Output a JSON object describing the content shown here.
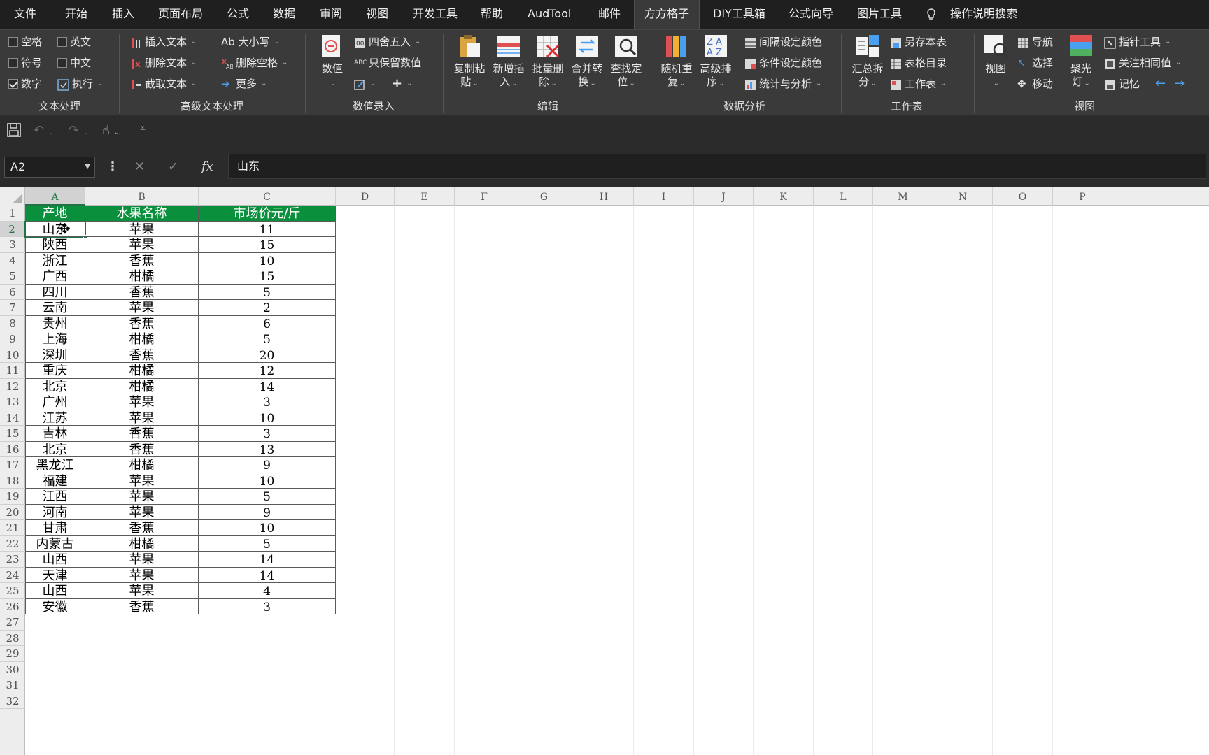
{
  "menu": {
    "tabs": [
      "文件",
      "开始",
      "插入",
      "页面布局",
      "公式",
      "数据",
      "审阅",
      "视图",
      "开发工具",
      "帮助",
      "AudTool",
      "邮件",
      "方方格子",
      "DIY工具箱",
      "公式向导",
      "图片工具"
    ],
    "active_tab": "方方格子",
    "search_label": "操作说明搜索"
  },
  "ribbon": {
    "text_processing": {
      "label": "文本处理",
      "checkboxes": [
        {
          "label": "空格",
          "checked": false
        },
        {
          "label": "英文",
          "checked": false
        },
        {
          "label": "符号",
          "checked": false
        },
        {
          "label": "中文",
          "checked": false
        },
        {
          "label": "数字",
          "checked": true
        }
      ],
      "execute_label": "执行"
    },
    "advanced_text": {
      "label": "高级文本处理",
      "insert_text": "插入文本",
      "delete_text": "删除文本",
      "extract_text": "截取文本",
      "case": "Ab 大小写",
      "delete_space": "删除空格",
      "more": "更多"
    },
    "number_entry": {
      "label": "数值录入",
      "value": "数值",
      "round": "四舍五入",
      "keep_numbers": "只保留数值"
    },
    "edit": {
      "label": "编辑",
      "buttons": [
        {
          "line1": "复制粘",
          "line2": "贴"
        },
        {
          "line1": "新增插",
          "line2": "入"
        },
        {
          "line1": "批量删",
          "line2": "除"
        },
        {
          "line1": "合并转",
          "line2": "换"
        },
        {
          "line1": "查找定",
          "line2": "位"
        }
      ]
    },
    "data_analysis": {
      "label": "数据分析",
      "random": {
        "line1": "随机重",
        "line2": "复"
      },
      "sort": {
        "line1": "高级排",
        "line2": "序"
      },
      "interval_color": "间隔设定颜色",
      "cond_color": "条件设定颜色",
      "stats": "统计与分析"
    },
    "worksheet": {
      "label": "工作表",
      "summary": {
        "line1": "汇总拆",
        "line2": "分"
      },
      "save_as": "另存本表",
      "toc": "表格目录",
      "sheet": "工作表"
    },
    "view": {
      "label": "视图",
      "view_btn": "视图",
      "nav": "导航",
      "select": "选择",
      "move": "移动",
      "spotlight": {
        "line1": "聚光",
        "line2": "灯"
      },
      "pointer_tool": "指针工具",
      "focus_same": "关注相同值",
      "memory": "记忆"
    }
  },
  "formula_bar": {
    "name_box": "A2",
    "fx": "fx",
    "content": "山东"
  },
  "grid": {
    "columns": [
      "A",
      "B",
      "C",
      "D",
      "E",
      "F",
      "G",
      "H",
      "I",
      "J",
      "K",
      "L",
      "M",
      "N",
      "O",
      "P"
    ],
    "rows": [
      "1",
      "2",
      "3",
      "4",
      "5",
      "6",
      "7",
      "8",
      "9",
      "10",
      "11",
      "12",
      "13",
      "14",
      "15",
      "16",
      "17",
      "18",
      "19",
      "20",
      "21",
      "22",
      "23",
      "24",
      "25",
      "26",
      "27",
      "28",
      "29",
      "30",
      "31",
      "32"
    ],
    "selected_column": "A",
    "selected_row": "2"
  },
  "table": {
    "headers": [
      "产地",
      "水果名称",
      "市场价元/斤"
    ],
    "rows": [
      [
        "山东",
        "苹果",
        "11"
      ],
      [
        "陕西",
        "苹果",
        "15"
      ],
      [
        "浙江",
        "香蕉",
        "10"
      ],
      [
        "广西",
        "柑橘",
        "15"
      ],
      [
        "四川",
        "香蕉",
        "5"
      ],
      [
        "云南",
        "苹果",
        "2"
      ],
      [
        "贵州",
        "香蕉",
        "6"
      ],
      [
        "上海",
        "柑橘",
        "5"
      ],
      [
        "深圳",
        "香蕉",
        "20"
      ],
      [
        "重庆",
        "柑橘",
        "12"
      ],
      [
        "北京",
        "柑橘",
        "14"
      ],
      [
        "广州",
        "苹果",
        "3"
      ],
      [
        "江苏",
        "苹果",
        "10"
      ],
      [
        "吉林",
        "香蕉",
        "3"
      ],
      [
        "北京",
        "香蕉",
        "13"
      ],
      [
        "黑龙江",
        "柑橘",
        "9"
      ],
      [
        "福建",
        "苹果",
        "10"
      ],
      [
        "江西",
        "苹果",
        "5"
      ],
      [
        "河南",
        "苹果",
        "9"
      ],
      [
        "甘肃",
        "香蕉",
        "10"
      ],
      [
        "内蒙古",
        "柑橘",
        "5"
      ],
      [
        "山西",
        "苹果",
        "14"
      ],
      [
        "天津",
        "苹果",
        "14"
      ],
      [
        "山西",
        "苹果",
        "4"
      ],
      [
        "安徽",
        "香蕉",
        "3"
      ]
    ]
  },
  "colors": {
    "header_green": "#0a8f3c",
    "selection_green": "#217346",
    "ribbon_bg": "#3a3a3a",
    "menu_bg": "#1f1f1f"
  }
}
